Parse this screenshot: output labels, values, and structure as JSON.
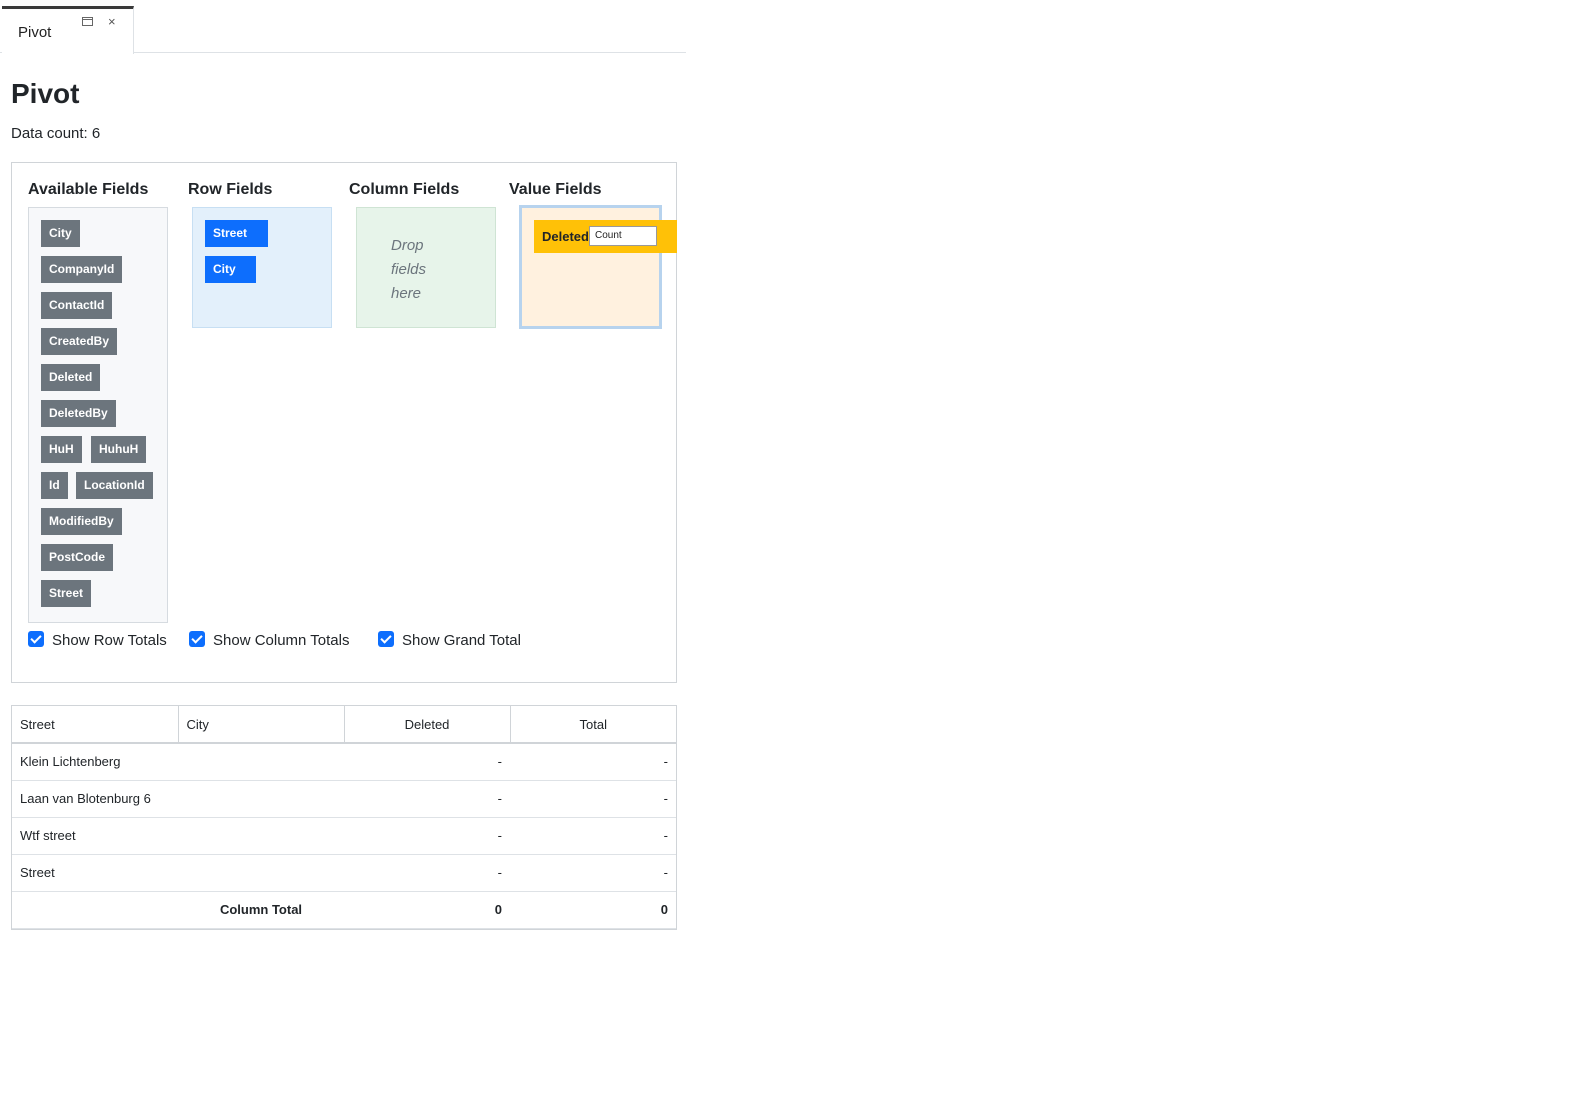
{
  "tab": {
    "label": "Pivot",
    "close_glyph": "×"
  },
  "page": {
    "title": "Pivot",
    "data_count": "Data count: 6"
  },
  "zones": {
    "available_title": "Available Fields",
    "rows_title": "Row Fields",
    "columns_title": "Column Fields",
    "values_title": "Value Fields",
    "drop_hint": "Drop fields here"
  },
  "available_fields": [
    "City",
    "CompanyId",
    "ContactId",
    "CreatedBy",
    "Deleted",
    "DeletedBy",
    "HuH",
    "HuhuH",
    "Id",
    "LocationId",
    "ModifiedBy",
    "PostCode",
    "Street"
  ],
  "row_fields": [
    "Street",
    "City"
  ],
  "value_field": {
    "name": "Deleted",
    "aggregate": "Count"
  },
  "options": {
    "show_row_totals": "Show Row Totals",
    "show_column_totals": "Show Column Totals",
    "show_grand_total": "Show Grand Total"
  },
  "table": {
    "headers": [
      "Street",
      "City",
      "Deleted",
      "Total"
    ],
    "rows": [
      {
        "street": "Klein Lichtenberg",
        "deleted": "-",
        "total": "-"
      },
      {
        "street": "Laan van Blotenburg 6",
        "deleted": "-",
        "total": "-"
      },
      {
        "street": "Wtf street",
        "deleted": "-",
        "total": "-"
      },
      {
        "street": "Street",
        "deleted": "-",
        "total": "-"
      }
    ],
    "total_row": {
      "label": "Column Total",
      "deleted": "0",
      "total": "0"
    }
  },
  "colors": {
    "accent": "#0d6efd",
    "chip": "#6c757d",
    "value_chip": "#ffc107"
  }
}
